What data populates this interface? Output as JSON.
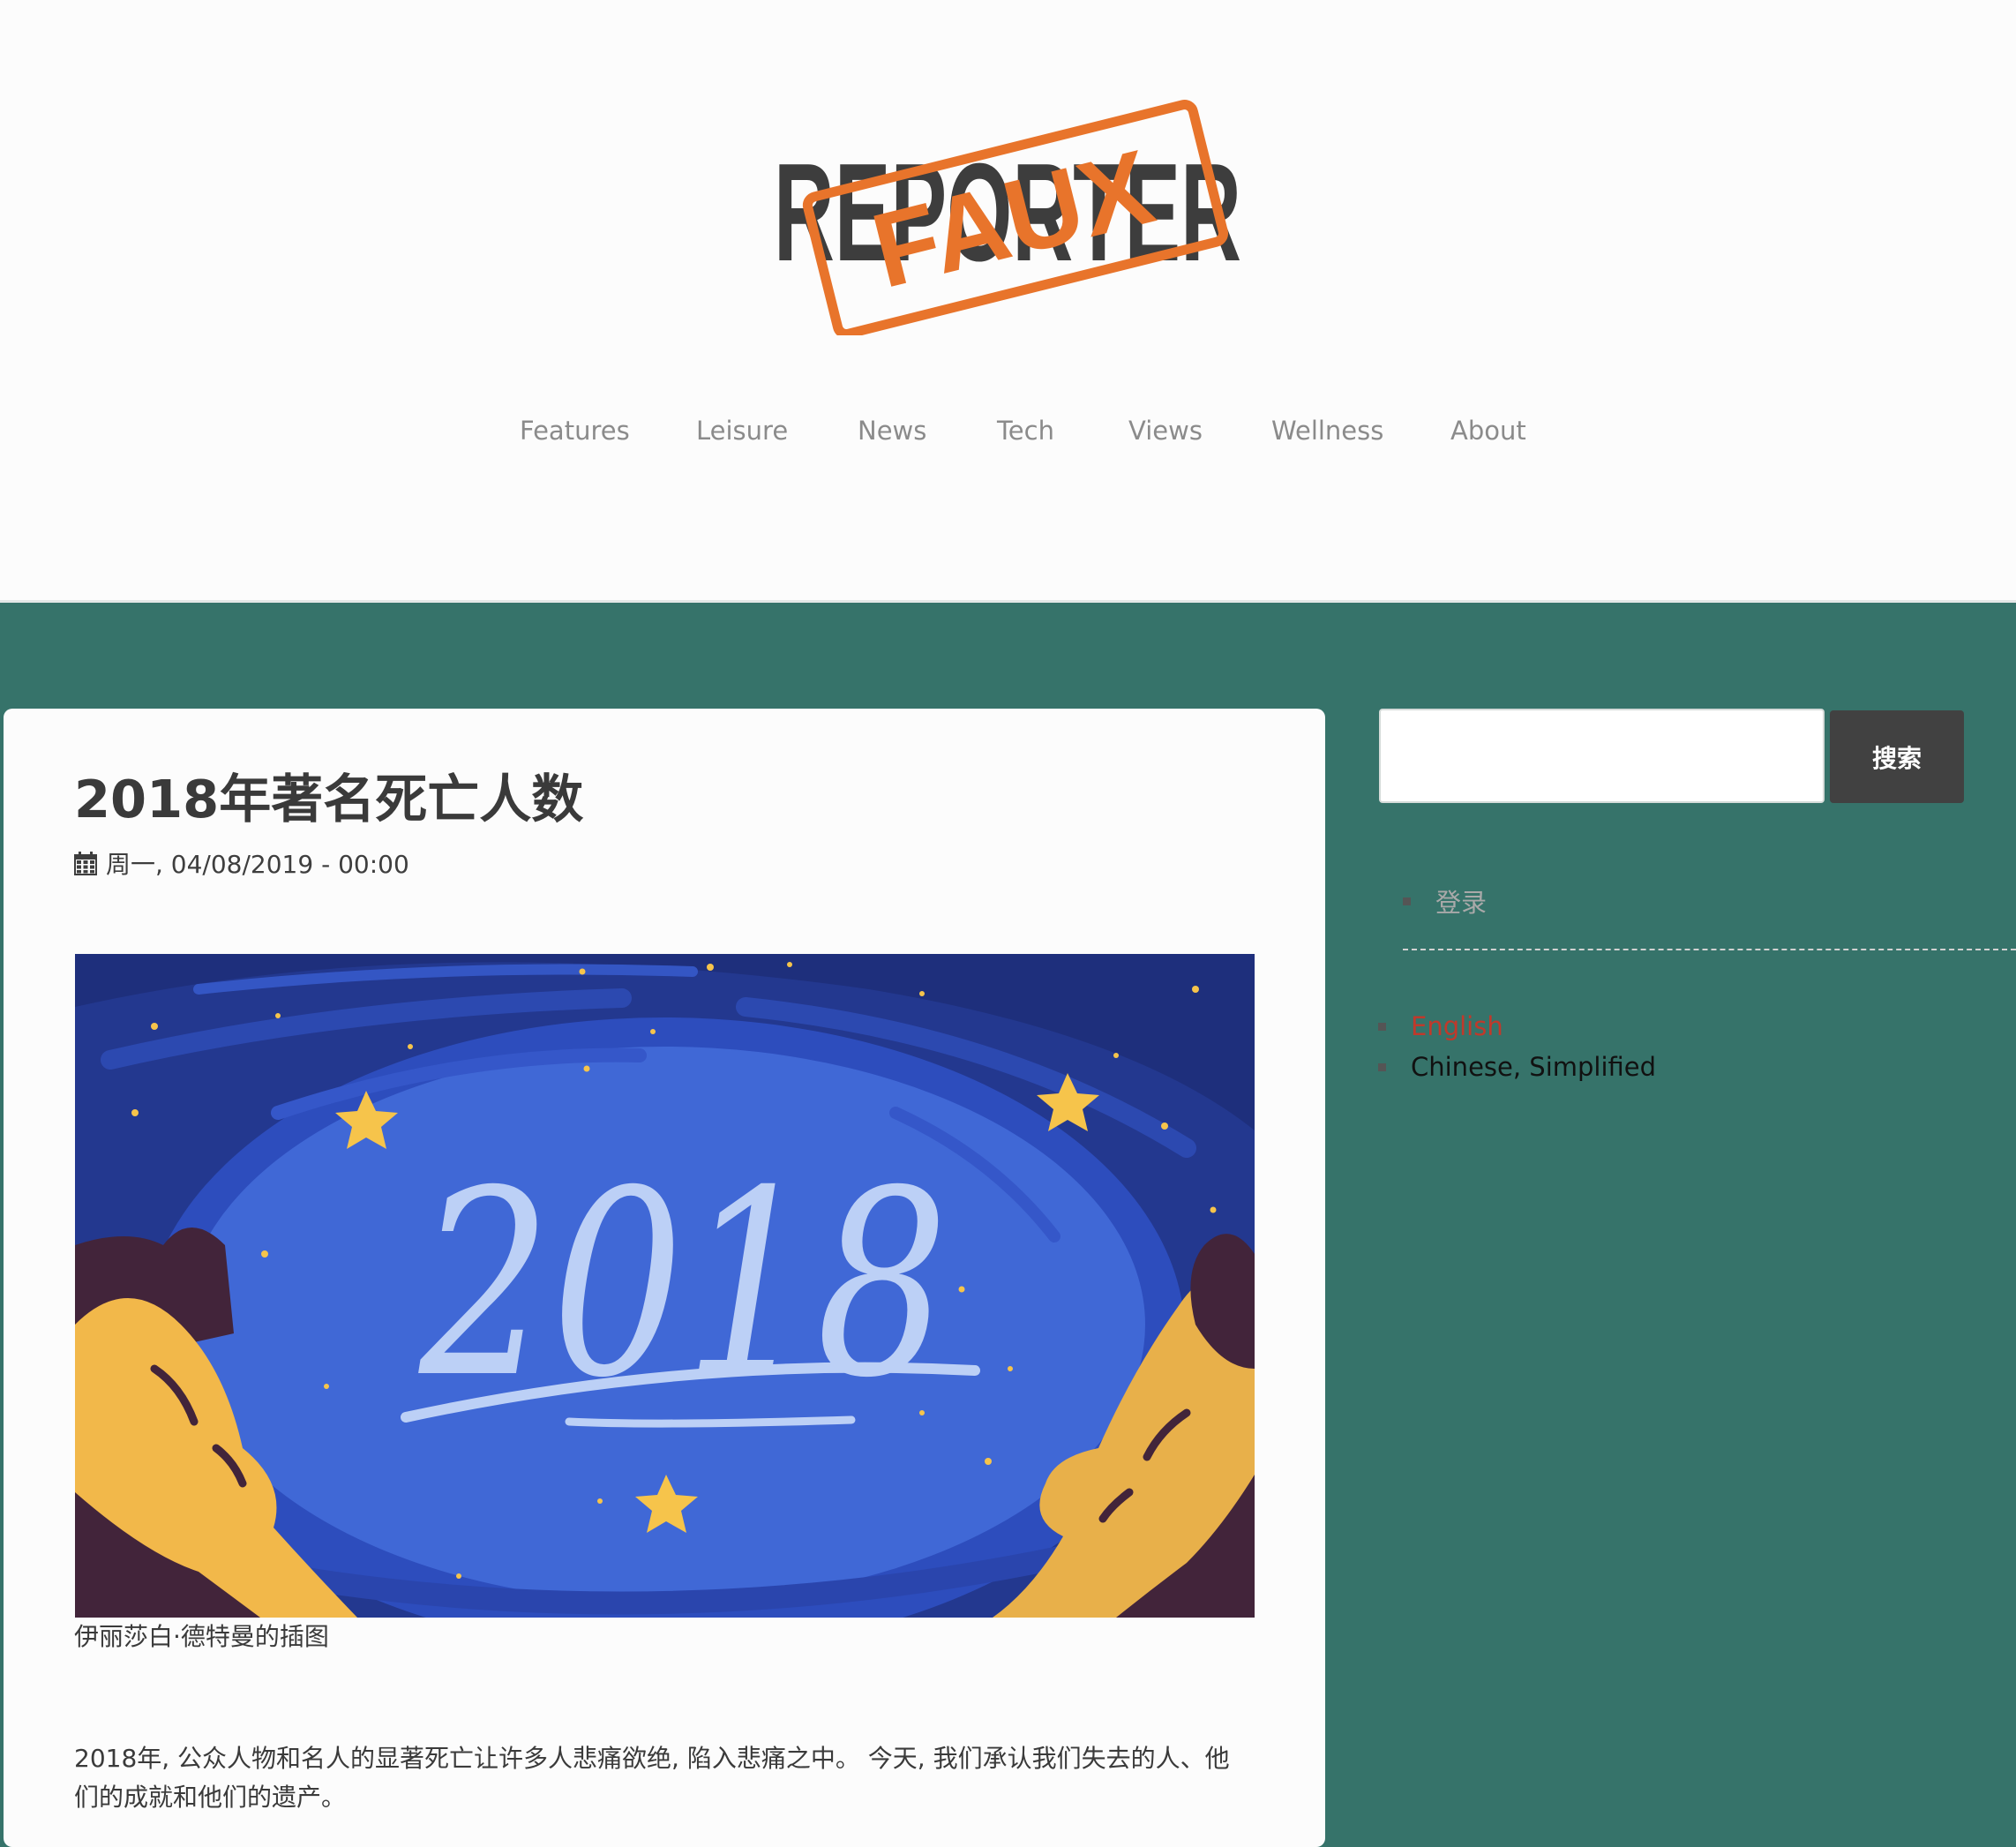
{
  "header": {
    "logo": {
      "word": "REPORTER",
      "stamp": "FAUX",
      "word_color": "#3d3d3d",
      "stamp_color": "#e8742b"
    },
    "nav": [
      "Features",
      "Leisure",
      "News",
      "Tech",
      "Views",
      "Wellness",
      "About"
    ]
  },
  "article": {
    "title": "2018年著名死亡人数",
    "date": "周一, 04/08/2019 - 00:00",
    "illustration_text": "2018",
    "caption": "伊丽莎白·德特曼的插图",
    "body": "2018年, 公众人物和名人的显著死亡让许多人悲痛欲绝, 陷入悲痛之中。 今天, 我们承认我们失去的人、他们的成就和他们的遗产。"
  },
  "sidebar": {
    "search_value": "",
    "search_button": "搜索",
    "user_menu": [
      "登录"
    ],
    "languages": [
      {
        "label": "English",
        "active": false
      },
      {
        "label": "Chinese, Simplified",
        "active": true
      }
    ]
  },
  "colors": {
    "background": "#36736a",
    "header_bg": "#fcfcfc",
    "nav_text": "#8b8b8b",
    "button_bg": "#414141",
    "link_red": "#c0392b"
  },
  "icons": {
    "date": "calendar-icon",
    "list": "square-bullet-icon"
  }
}
